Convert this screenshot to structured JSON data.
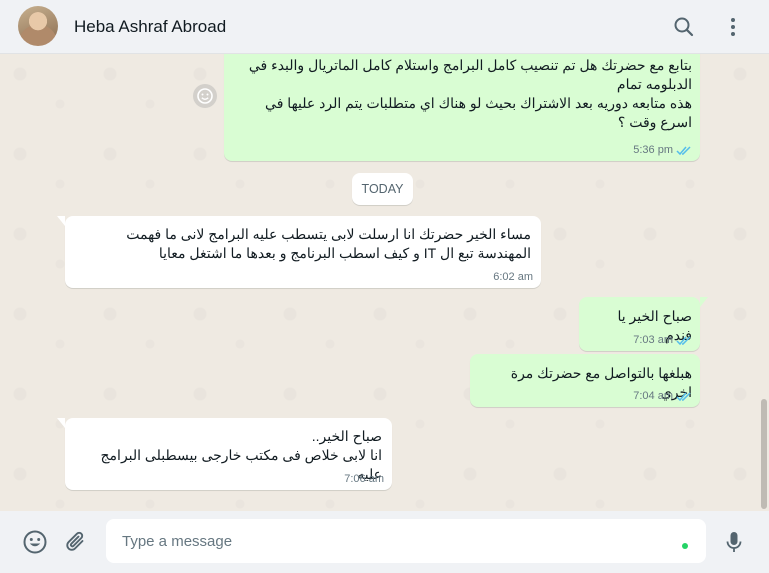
{
  "header": {
    "contact_name": "Heba Ashraf Abroad",
    "avatar_icon": "contact-avatar",
    "search_icon": "search-icon",
    "menu_icon": "more-vertical-icon"
  },
  "messages": [
    {
      "direction": "out",
      "text": "بتابع مع حضرتك هل تم تنصيب كامل البرامج واستلام كامل الماتريال والبدء في الدبلومه تمام\nهذه متابعه دوريه بعد الاشتراك بحيث لو هناك اي متطلبات يتم الرد عليها في اسرع وقت ؟",
      "time": "5:36 pm",
      "status": "read"
    },
    {
      "direction": "in",
      "text": "مساء الخير حضرتك انا ارسلت لابى يتسطب عليه البرامج لانى ما فهمت المهندسة تبع ال IT و كيف اسطب البرنامج و بعدها ما اشتغل معايا",
      "time": "6:02 am"
    },
    {
      "direction": "out",
      "text": "صباح الخير يا فندم",
      "time": "7:03 am",
      "status": "read"
    },
    {
      "direction": "out",
      "text": "هبلغها بالتواصل مع حضرتك مرة اخري",
      "time": "7:04 am",
      "status": "read"
    },
    {
      "direction": "in",
      "text": "صباح الخير..\nانا لابى خلاص فى مكتب خارجى بيسطبلى البرامج عليه",
      "time": "7:06 am"
    }
  ],
  "day_separator": "TODAY",
  "footer": {
    "placeholder": "Type a message",
    "emoji_icon": "emoji-icon",
    "attach_icon": "paperclip-icon",
    "mic_icon": "microphone-icon"
  },
  "colors": {
    "outgoing_bubble": "#d9fdd3",
    "incoming_bubble": "#ffffff",
    "chat_background": "#efeae2",
    "read_ticks": "#53bdeb"
  }
}
